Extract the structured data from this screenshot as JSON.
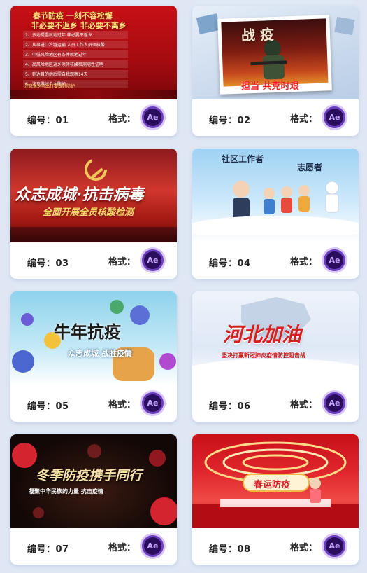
{
  "labels": {
    "number_prefix": "编号：",
    "format_prefix": "格式：",
    "ae_icon_text": "Ae"
  },
  "cards": [
    {
      "id": "01",
      "title_line1": "春节防疫 一刻不容松懈",
      "title_line2": "非必要不返乡 非必要不离乡",
      "list": [
        "1、多地提倡就地过年 非必要不返乡",
        "2、从事进口冷链运输 人员工作人员须核酸",
        "3、中低风险地区有条件就地过年",
        "4、高风险地区返乡须持核酸检测阴性证明",
        "5、到达目的地后需自我观察14天",
        "6、注意做好个人防护"
      ],
      "notice": "注意返乡与出行要做好防护"
    },
    {
      "id": "02",
      "title": "战 疫",
      "subtitle": "担当 共克时艰"
    },
    {
      "id": "03",
      "title": "众志成城·抗击病毒",
      "subtitle": "全面开展全员核酸检测"
    },
    {
      "id": "04",
      "title_a": "社区工作者",
      "title_b": "志愿者"
    },
    {
      "id": "05",
      "title": "牛年抗疫",
      "subtitle": "众志成城 战胜疫情"
    },
    {
      "id": "06",
      "title": "河北加油",
      "subtitle": "坚决打赢新冠肺炎疫情防控阻击战"
    },
    {
      "id": "07",
      "title": "冬季防疫携手同行",
      "subtitle": "凝聚中华民族的力量 抗击疫情"
    },
    {
      "id": "08",
      "title": "春运防疫"
    }
  ],
  "colors": {
    "ae_ring": "#6b3fbf",
    "ae_bg": "#2a0d5c",
    "ae_text": "#c9a8ff",
    "page_bg": "#dfe7f5"
  }
}
